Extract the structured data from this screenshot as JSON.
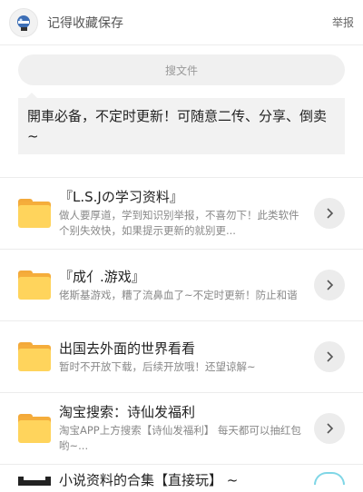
{
  "header": {
    "brand": "记得收藏保存",
    "report": "举报"
  },
  "search": {
    "placeholder": "搜文件"
  },
  "notice": {
    "text": "開車必备，不定时更新！可随意二传、分享、倒卖~"
  },
  "items": [
    {
      "title": "『L.S.Jの学习资料』",
      "desc": "做人要厚道，学到知识别举报，不喜勿下！此类软件个别失效快，如果提示更新的就别更..."
    },
    {
      "title": "『成亻.游戏』",
      "desc": "佬斯基游戏，糟了流鼻血了~不定时更新！防止和谐"
    },
    {
      "title": "出国去外面的世界看看",
      "desc": "暂时不开放下载，后续开放哦！还望谅解~"
    },
    {
      "title": "淘宝搜索：诗仙发福利",
      "desc": "淘宝APP上方搜索【诗仙发福利】 每天都可以抽红包哟~..."
    }
  ],
  "partial": {
    "title": "小说资料的合集【直接玩】 ~"
  },
  "icons": {
    "avatar": "helmet-avatar-icon",
    "folder": "folder-icon",
    "arrow": "chevron-right-icon"
  },
  "colors": {
    "folder_front": "#ffd45c",
    "folder_back": "#f5ad3b",
    "accent_ring": "#7fd6e6"
  }
}
